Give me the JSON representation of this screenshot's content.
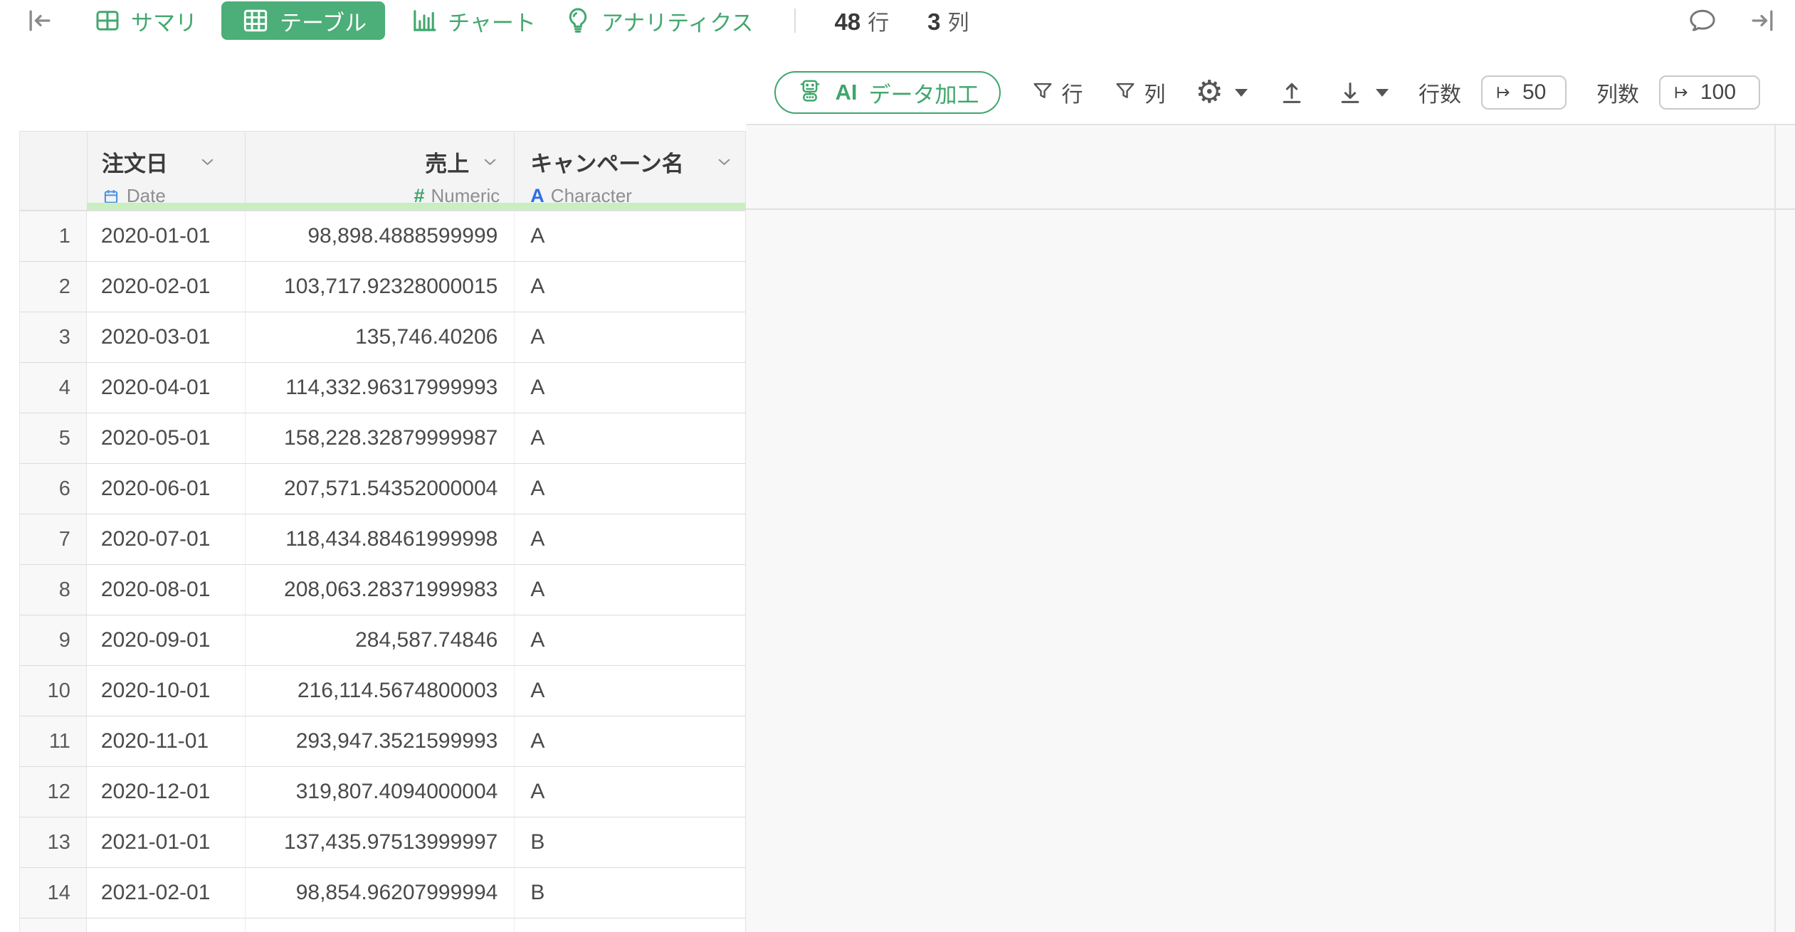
{
  "topbar": {
    "tabs": [
      {
        "label": "サマリ"
      },
      {
        "label": "テーブル"
      },
      {
        "label": "チャート"
      },
      {
        "label": "アナリティクス"
      }
    ],
    "stats": {
      "rows_value": "48",
      "rows_unit": "行",
      "cols_value": "3",
      "cols_unit": "列"
    }
  },
  "toolbar": {
    "ai_button": {
      "prefix": "AI",
      "label": "データ加工"
    },
    "filter_rows_label": "行",
    "filter_cols_label": "列",
    "rows_limit": {
      "label": "行数",
      "value": "50"
    },
    "cols_limit": {
      "label": "列数",
      "value": "100"
    }
  },
  "table": {
    "columns": [
      {
        "name": "注文日",
        "type_label": "Date"
      },
      {
        "name": "売上",
        "type_symbol": "#",
        "type_label": "Numeric"
      },
      {
        "name": "キャンペーン名",
        "type_symbol": "A",
        "type_label": "Character"
      }
    ],
    "rows": [
      {
        "num": "1",
        "date": "2020-01-01",
        "sales": "98,898.4888599999",
        "campaign": "A"
      },
      {
        "num": "2",
        "date": "2020-02-01",
        "sales": "103,717.92328000015",
        "campaign": "A"
      },
      {
        "num": "3",
        "date": "2020-03-01",
        "sales": "135,746.40206",
        "campaign": "A"
      },
      {
        "num": "4",
        "date": "2020-04-01",
        "sales": "114,332.96317999993",
        "campaign": "A"
      },
      {
        "num": "5",
        "date": "2020-05-01",
        "sales": "158,228.32879999987",
        "campaign": "A"
      },
      {
        "num": "6",
        "date": "2020-06-01",
        "sales": "207,571.54352000004",
        "campaign": "A"
      },
      {
        "num": "7",
        "date": "2020-07-01",
        "sales": "118,434.88461999998",
        "campaign": "A"
      },
      {
        "num": "8",
        "date": "2020-08-01",
        "sales": "208,063.28371999983",
        "campaign": "A"
      },
      {
        "num": "9",
        "date": "2020-09-01",
        "sales": "284,587.74846",
        "campaign": "A"
      },
      {
        "num": "10",
        "date": "2020-10-01",
        "sales": "216,114.5674800003",
        "campaign": "A"
      },
      {
        "num": "11",
        "date": "2020-11-01",
        "sales": "293,947.3521599993",
        "campaign": "A"
      },
      {
        "num": "12",
        "date": "2020-12-01",
        "sales": "319,807.4094000004",
        "campaign": "A"
      },
      {
        "num": "13",
        "date": "2021-01-01",
        "sales": "137,435.97513999997",
        "campaign": "B"
      },
      {
        "num": "14",
        "date": "2021-02-01",
        "sales": "98,854.96207999994",
        "campaign": "B"
      }
    ]
  },
  "colors": {
    "accent_green": "#3fa66b",
    "active_tab_bg": "#4cae78",
    "header_underline_green": "#c9eec0",
    "date_type_blue": "#4a90e2",
    "character_type_blue": "#2e6fe8",
    "numeric_type_green": "#3fa66b",
    "header_bg": "#f4f4f5",
    "panel_bg": "#f8f8f8"
  }
}
